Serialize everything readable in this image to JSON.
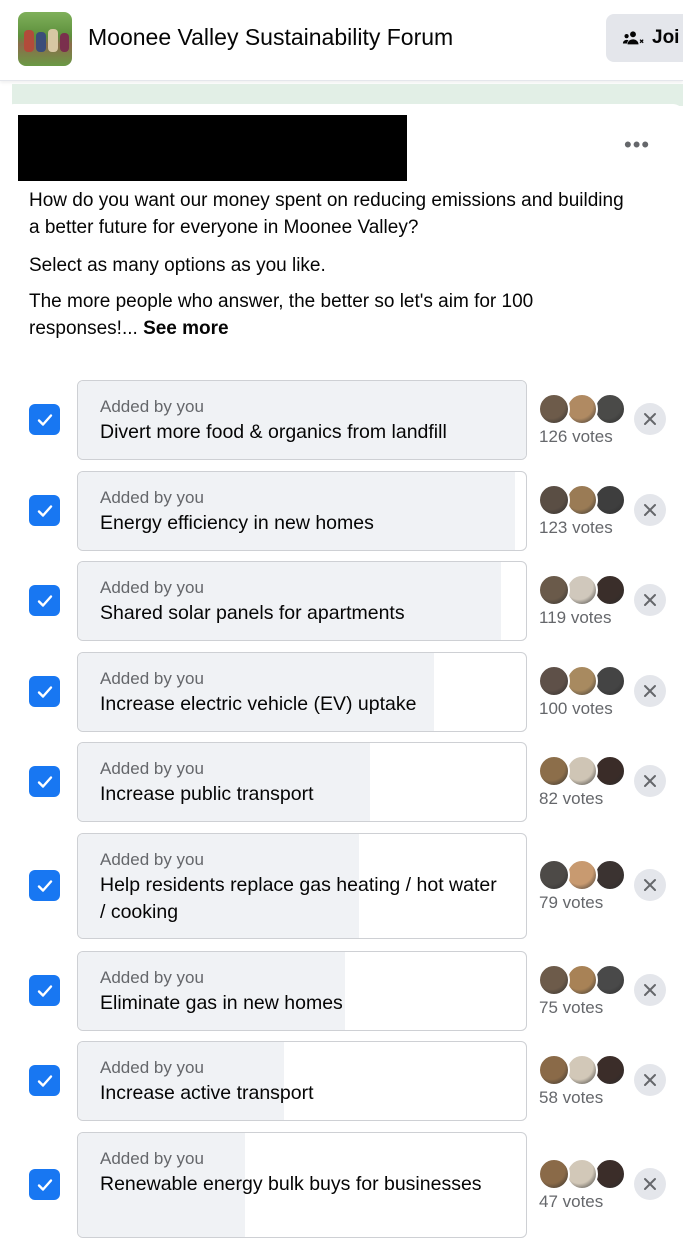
{
  "header": {
    "group_name": "Moonee Valley Sustainability Forum",
    "join_label": "Joi"
  },
  "post": {
    "paragraph_1": "How do you want our money spent on reducing emissions and building a better future for everyone in Moonee Valley?",
    "paragraph_2": "Select as many options as you like.",
    "paragraph_3": "The more people who answer, the better so let's aim for 100 responses!... ",
    "see_more": "See more"
  },
  "poll": {
    "options": [
      {
        "added_by": "Added by you",
        "label": "Divert more food & organics from landfill",
        "votes": "126 votes",
        "vote_count": 126,
        "checked": true
      },
      {
        "added_by": "Added by you",
        "label": "Energy efficiency in new homes",
        "votes": "123 votes",
        "vote_count": 123,
        "checked": true
      },
      {
        "added_by": "Added by you",
        "label": "Shared solar panels for apartments",
        "votes": "119 votes",
        "vote_count": 119,
        "checked": true
      },
      {
        "added_by": "Added by you",
        "label": "Increase electric vehicle (EV) uptake",
        "votes": "100 votes",
        "vote_count": 100,
        "checked": true
      },
      {
        "added_by": "Added by you",
        "label": "Increase public transport",
        "votes": "82 votes",
        "vote_count": 82,
        "checked": true
      },
      {
        "added_by": "Added by you",
        "label": "Help residents replace gas heating / hot water / cooking",
        "votes": "79 votes",
        "vote_count": 79,
        "checked": true
      },
      {
        "added_by": "Added by you",
        "label": "Eliminate gas in new homes",
        "votes": "75 votes",
        "vote_count": 75,
        "checked": true
      },
      {
        "added_by": "Added by you",
        "label": "Increase active transport",
        "votes": "58 votes",
        "vote_count": 58,
        "checked": true
      },
      {
        "added_by": "Added by you",
        "label": "Renewable energy bulk buys for businesses",
        "votes": "47 votes",
        "vote_count": 47,
        "checked": true
      }
    ]
  },
  "colors": {
    "accent": "#1877f2",
    "bar_fill": "#f0f2f5",
    "secondary_text": "#65676b"
  }
}
